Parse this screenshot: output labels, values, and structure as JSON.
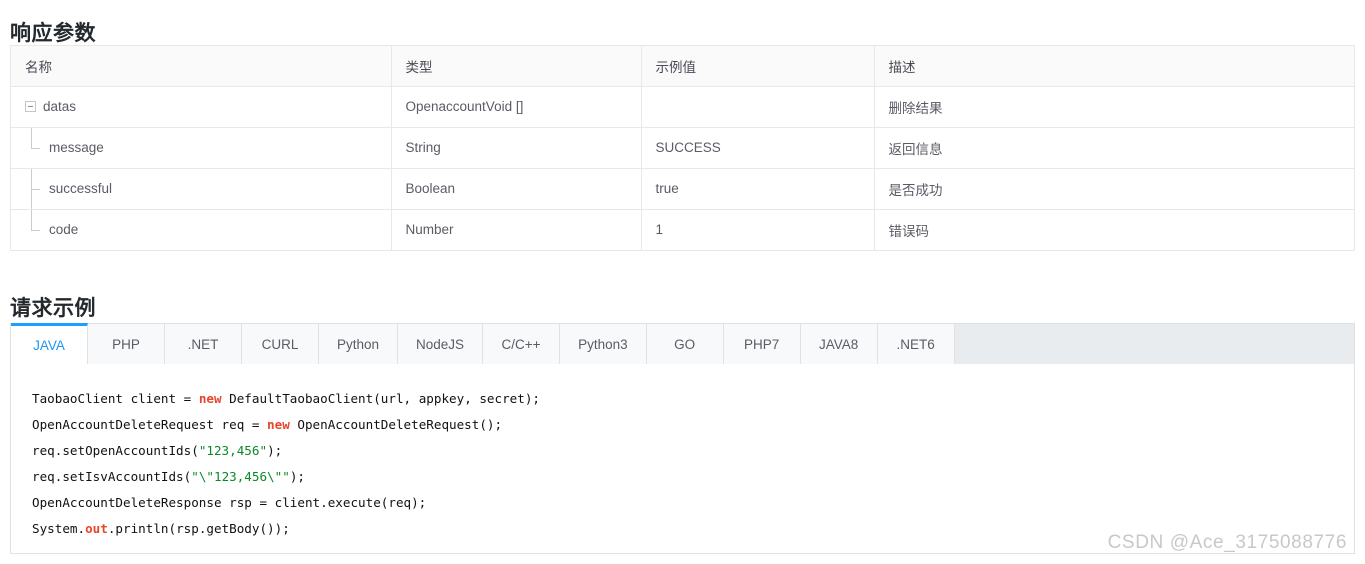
{
  "response_section": {
    "title": "响应参数",
    "columns": [
      "名称",
      "类型",
      "示例值",
      "描述"
    ],
    "rows": [
      {
        "name": "datas",
        "type": "OpenaccountVoid []",
        "example": "",
        "desc": "删除结果",
        "level": 0,
        "expander": "minus"
      },
      {
        "name": "message",
        "type": "String",
        "example": "SUCCESS",
        "desc": "返回信息",
        "level": 1,
        "expander": "none"
      },
      {
        "name": "successful",
        "type": "Boolean",
        "example": "true",
        "desc": "是否成功",
        "level": 1,
        "expander": "none"
      },
      {
        "name": "code",
        "type": "Number",
        "example": "1",
        "desc": "错误码",
        "level": 1,
        "expander": "none"
      }
    ]
  },
  "request_section": {
    "title": "请求示例",
    "tabs": [
      {
        "label": "JAVA",
        "active": true
      },
      {
        "label": "PHP",
        "active": false
      },
      {
        "label": ".NET",
        "active": false
      },
      {
        "label": "CURL",
        "active": false
      },
      {
        "label": "Python",
        "active": false
      },
      {
        "label": "NodeJS",
        "active": false
      },
      {
        "label": "C/C++",
        "active": false
      },
      {
        "label": "Python3",
        "active": false
      },
      {
        "label": "GO",
        "active": false
      },
      {
        "label": "PHP7",
        "active": false
      },
      {
        "label": "JAVA8",
        "active": false
      },
      {
        "label": ".NET6",
        "active": false
      }
    ],
    "code_lines": [
      [
        {
          "t": "TaobaoClient client = ",
          "c": "plain"
        },
        {
          "t": "new",
          "c": "kw"
        },
        {
          "t": " DefaultTaobaoClient(url, appkey, secret);",
          "c": "plain"
        }
      ],
      [
        {
          "t": "OpenAccountDeleteRequest req = ",
          "c": "plain"
        },
        {
          "t": "new",
          "c": "kw"
        },
        {
          "t": " OpenAccountDeleteRequest();",
          "c": "plain"
        }
      ],
      [
        {
          "t": "req.setOpenAccountIds(",
          "c": "plain"
        },
        {
          "t": "\"123,456\"",
          "c": "str"
        },
        {
          "t": ");",
          "c": "plain"
        }
      ],
      [
        {
          "t": "req.setIsvAccountIds(",
          "c": "plain"
        },
        {
          "t": "\"\\\"123,456\\\"\"",
          "c": "str"
        },
        {
          "t": ");",
          "c": "plain"
        }
      ],
      [
        {
          "t": "OpenAccountDeleteResponse rsp = client.execute(req);",
          "c": "plain"
        }
      ],
      [
        {
          "t": "System.",
          "c": "plain"
        },
        {
          "t": "out",
          "c": "kw"
        },
        {
          "t": ".println(rsp.getBody());",
          "c": "plain"
        }
      ]
    ]
  },
  "watermark": {
    "text": "CSDN @Ace_3175088776"
  },
  "colors": {
    "accent": "#1e9fff",
    "active_tab_text": "#2196f3",
    "keyword": "#e8452c",
    "string": "#0a8a26",
    "table_border": "#e8e8e8",
    "header_bg": "#fafafa",
    "tabbar_bg": "#e9ecef"
  }
}
